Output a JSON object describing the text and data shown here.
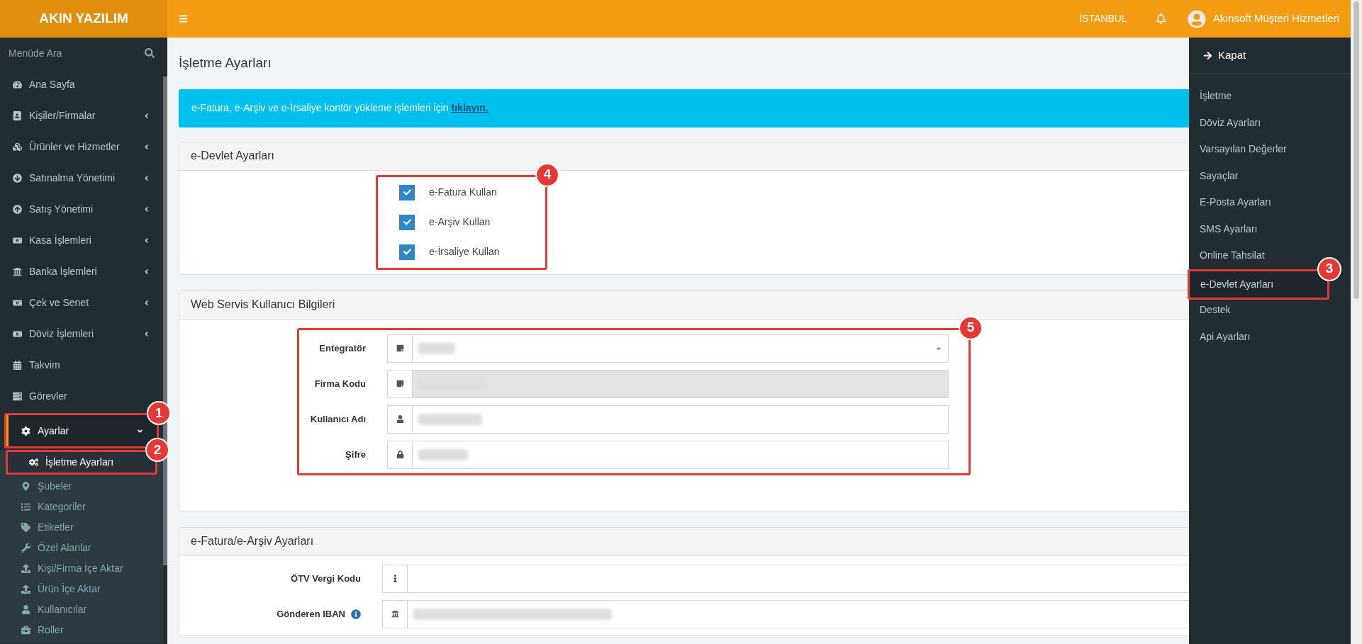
{
  "brand": "AKIN YAZILIM",
  "menu_search": {
    "placeholder": "Menüde Ara"
  },
  "sidebar": {
    "items": [
      {
        "label": "Ana Sayfa",
        "expandable": false,
        "selected": false
      },
      {
        "label": "Kişiler/Firmalar",
        "expandable": true,
        "selected": false
      },
      {
        "label": "Ürünler ve Hizmetler",
        "expandable": true,
        "selected": false
      },
      {
        "label": "Satınalma Yönetimi",
        "expandable": true,
        "selected": false
      },
      {
        "label": "Satış Yönetimi",
        "expandable": true,
        "selected": false
      },
      {
        "label": "Kasa İşlemleri",
        "expandable": true,
        "selected": false
      },
      {
        "label": "Banka İşlemleri",
        "expandable": true,
        "selected": false
      },
      {
        "label": "Çek ve Senet",
        "expandable": true,
        "selected": false
      },
      {
        "label": "Döviz İşlemleri",
        "expandable": true,
        "selected": false
      },
      {
        "label": "Takvim",
        "expandable": false,
        "selected": false
      },
      {
        "label": "Görevler",
        "expandable": false,
        "selected": false
      },
      {
        "label": "Ayarlar",
        "expandable": true,
        "expanded": true,
        "selected": true,
        "callout": "1",
        "children": [
          {
            "label": "İşletme Ayarları",
            "selected": true,
            "callout": "2"
          },
          {
            "label": "Şubeler",
            "selected": false
          },
          {
            "label": "Kategoriler",
            "selected": false
          },
          {
            "label": "Etiketler",
            "selected": false
          },
          {
            "label": "Özel Alanlar",
            "selected": false
          },
          {
            "label": "Kişi/Firma İçe Aktar",
            "selected": false
          },
          {
            "label": "Ürün İçe Aktar",
            "selected": false
          },
          {
            "label": "Kullanıcılar",
            "selected": false
          },
          {
            "label": "Roller",
            "selected": false
          }
        ]
      }
    ]
  },
  "topbar": {
    "location": "İSTANBUL",
    "user": "Akınsoft Müşteri Hizmetleri"
  },
  "page_title": "İşletme Ayarları",
  "alert": {
    "text": "e-Fatura, e-Arşiv ve e-İrsaliye kontör yükleme işlemleri için",
    "link": "tıklayın."
  },
  "panels": [
    {
      "title": "e-Devlet Ayarları",
      "kind": "checkboxes",
      "callout": "4",
      "checkboxes": [
        {
          "label": "e-Fatura Kullan",
          "checked": true
        },
        {
          "label": "e-Arşiv Kullan",
          "checked": true
        },
        {
          "label": "e-İrsaliye Kullan",
          "checked": true
        }
      ]
    },
    {
      "title": "Web Servis Kullanıcı Bilgileri",
      "kind": "fields",
      "callout": "5",
      "fields": [
        {
          "label": "Entegratör",
          "kind": "select",
          "disabled": false,
          "redacted": true
        },
        {
          "label": "Firma Kodu",
          "kind": "input",
          "disabled": true,
          "redacted": true
        },
        {
          "label": "Kullanıcı Adı",
          "kind": "input",
          "disabled": false,
          "redacted": true
        },
        {
          "label": "Şifre",
          "kind": "input",
          "disabled": false,
          "redacted": true
        }
      ]
    },
    {
      "title": "e-Fatura/e-Arşiv Ayarları",
      "kind": "fields",
      "fields": [
        {
          "label": "ÖTV Vergi Kodu",
          "kind": "input",
          "disabled": false,
          "redacted": false
        },
        {
          "label": "Gönderen IBAN",
          "kind": "input",
          "disabled": false,
          "redacted": true,
          "info": true
        }
      ]
    }
  ],
  "settings_menu": {
    "close": "Kapat",
    "items": [
      {
        "label": "İşletme",
        "selected": false
      },
      {
        "label": "Döviz Ayarları",
        "selected": false
      },
      {
        "label": "Varsayılan Değerler",
        "selected": false
      },
      {
        "label": "Sayaçlar",
        "selected": false
      },
      {
        "label": "E-Posta Ayarları",
        "selected": false
      },
      {
        "label": "SMS Ayarları",
        "selected": false
      },
      {
        "label": "Online Tahsilat",
        "selected": false
      },
      {
        "label": "e-Devlet Ayarları",
        "selected": true,
        "callout": "3"
      },
      {
        "label": "Destek",
        "selected": false
      },
      {
        "label": "Api Ayarları",
        "selected": false
      }
    ]
  }
}
